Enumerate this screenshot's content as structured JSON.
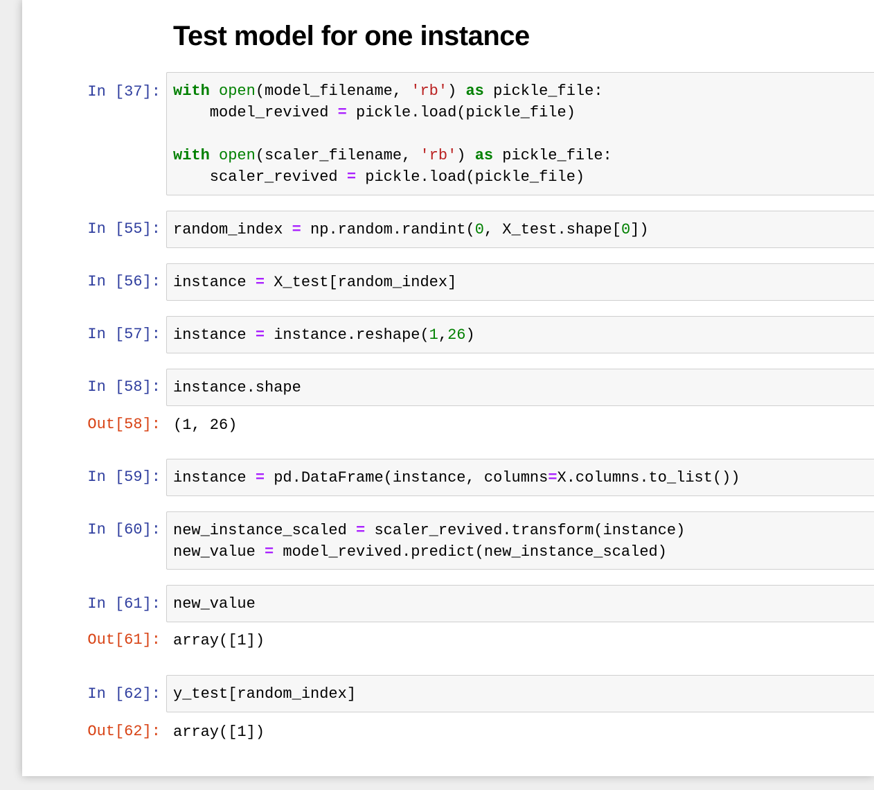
{
  "heading": "Test model for one instance",
  "cells": [
    {
      "prompt": "In [37]:",
      "lines": [
        [
          {
            "t": "with",
            "c": "kw"
          },
          {
            "t": " "
          },
          {
            "t": "open",
            "c": "bi"
          },
          {
            "t": "(model_filename, "
          },
          {
            "t": "'rb'",
            "c": "str"
          },
          {
            "t": ") "
          },
          {
            "t": "as",
            "c": "kw"
          },
          {
            "t": " pickle_file:"
          }
        ],
        [
          {
            "t": "    model_revived "
          },
          {
            "t": "=",
            "c": "op"
          },
          {
            "t": " pickle.load(pickle_file)"
          }
        ],
        [],
        [
          {
            "t": "with",
            "c": "kw"
          },
          {
            "t": " "
          },
          {
            "t": "open",
            "c": "bi"
          },
          {
            "t": "(scaler_filename, "
          },
          {
            "t": "'rb'",
            "c": "str"
          },
          {
            "t": ") "
          },
          {
            "t": "as",
            "c": "kw"
          },
          {
            "t": " pickle_file:"
          }
        ],
        [
          {
            "t": "    scaler_revived "
          },
          {
            "t": "=",
            "c": "op"
          },
          {
            "t": " pickle.load(pickle_file)"
          }
        ]
      ]
    },
    {
      "prompt": "In [55]:",
      "lines": [
        [
          {
            "t": "random_index "
          },
          {
            "t": "=",
            "c": "op"
          },
          {
            "t": " np.random.randint("
          },
          {
            "t": "0",
            "c": "num"
          },
          {
            "t": ", X_test.shape["
          },
          {
            "t": "0",
            "c": "num"
          },
          {
            "t": "])"
          }
        ]
      ]
    },
    {
      "prompt": "In [56]:",
      "lines": [
        [
          {
            "t": "instance "
          },
          {
            "t": "=",
            "c": "op"
          },
          {
            "t": " X_test[random_index]"
          }
        ]
      ]
    },
    {
      "prompt": "In [57]:",
      "lines": [
        [
          {
            "t": "instance "
          },
          {
            "t": "=",
            "c": "op"
          },
          {
            "t": " instance.reshape("
          },
          {
            "t": "1",
            "c": "num"
          },
          {
            "t": ","
          },
          {
            "t": "26",
            "c": "num"
          },
          {
            "t": ")"
          }
        ]
      ]
    },
    {
      "prompt": "In [58]:",
      "lines": [
        [
          {
            "t": "instance.shape"
          }
        ]
      ],
      "out_prompt": "Out[58]:",
      "output": "(1, 26)"
    },
    {
      "prompt": "In [59]:",
      "lines": [
        [
          {
            "t": "instance "
          },
          {
            "t": "=",
            "c": "op"
          },
          {
            "t": " pd.DataFrame(instance, columns"
          },
          {
            "t": "=",
            "c": "op"
          },
          {
            "t": "X.columns.to_list())"
          }
        ]
      ]
    },
    {
      "prompt": "In [60]:",
      "lines": [
        [
          {
            "t": "new_instance_scaled "
          },
          {
            "t": "=",
            "c": "op"
          },
          {
            "t": " scaler_revived.transform(instance)"
          }
        ],
        [
          {
            "t": "new_value "
          },
          {
            "t": "=",
            "c": "op"
          },
          {
            "t": " model_revived.predict(new_instance_scaled)"
          }
        ]
      ]
    },
    {
      "prompt": "In [61]:",
      "lines": [
        [
          {
            "t": "new_value"
          }
        ]
      ],
      "out_prompt": "Out[61]:",
      "output": "array([1])"
    },
    {
      "prompt": "In [62]:",
      "lines": [
        [
          {
            "t": "y_test[random_index]"
          }
        ]
      ],
      "out_prompt": "Out[62]:",
      "output": "array([1])"
    }
  ]
}
